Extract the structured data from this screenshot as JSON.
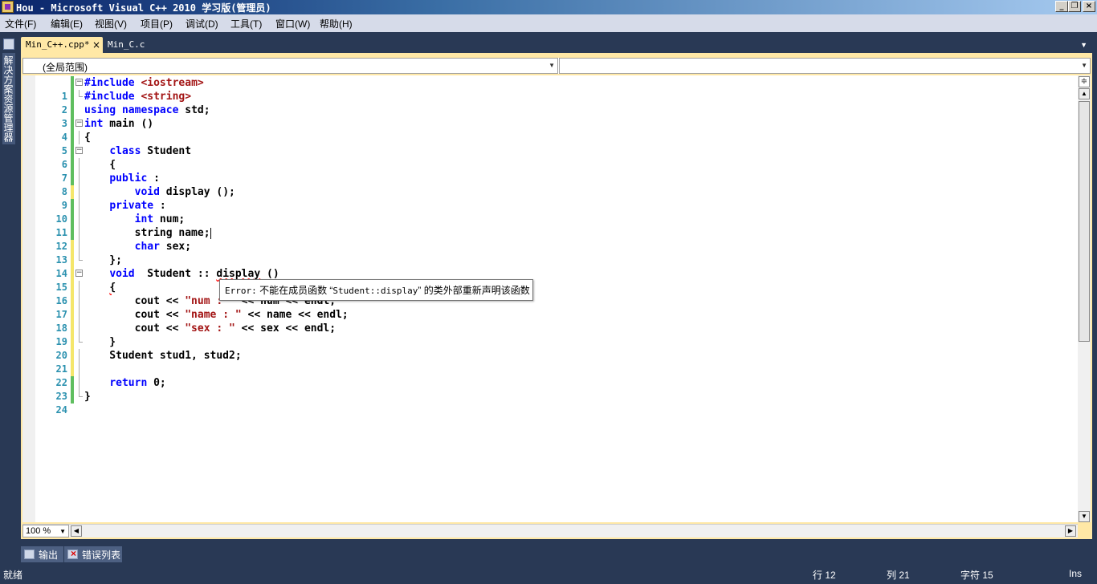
{
  "window": {
    "title": "Hou - Microsoft Visual C++ 2010 学习版(管理员)",
    "minimize": "_",
    "maximize": "❐",
    "close": "×"
  },
  "menu": [
    {
      "label": "文件(F)"
    },
    {
      "label": "编辑(E)"
    },
    {
      "label": "视图(V)"
    },
    {
      "label": "项目(P)"
    },
    {
      "label": "调试(D)"
    },
    {
      "label": "工具(T)"
    },
    {
      "label": "窗口(W)"
    },
    {
      "label": "帮助(H)"
    }
  ],
  "sidebar": {
    "solution_explorer_label": "解决方案资源管理器",
    "icon": "solution-explorer-icon"
  },
  "tabs": [
    {
      "label": "Min_C++.cpp*",
      "active": true,
      "close": "×"
    },
    {
      "label": "Min_C.c",
      "active": false
    }
  ],
  "navbar": {
    "scope": "(全局范围)",
    "member": ""
  },
  "editor": {
    "lines": [
      {
        "n": "1",
        "text": "#include <iostream>"
      },
      {
        "n": "2",
        "text": "#include <string>"
      },
      {
        "n": "3",
        "text": "using namespace std;"
      },
      {
        "n": "4",
        "text": "int main ()"
      },
      {
        "n": "5",
        "text": "{"
      },
      {
        "n": "6",
        "text": "    class Student"
      },
      {
        "n": "7",
        "text": "    {"
      },
      {
        "n": "8",
        "text": "    public :"
      },
      {
        "n": "9",
        "text": "        void display ();"
      },
      {
        "n": "10",
        "text": "    private :"
      },
      {
        "n": "11",
        "text": "        int num;"
      },
      {
        "n": "12",
        "text": "        string name;"
      },
      {
        "n": "13",
        "text": "        char sex;"
      },
      {
        "n": "14",
        "text": "    };"
      },
      {
        "n": "15",
        "text": "    void  Student :: display ()"
      },
      {
        "n": "16",
        "text": "    {"
      },
      {
        "n": "17",
        "text": "        cout << \"num : \" << num << endl;"
      },
      {
        "n": "18",
        "text": "        cout << \"name : \" << name << endl;"
      },
      {
        "n": "19",
        "text": "        cout << \"sex : \" << sex << endl;"
      },
      {
        "n": "20",
        "text": "    }"
      },
      {
        "n": "21",
        "text": "    Student stud1, stud2;"
      },
      {
        "n": "22",
        "text": ""
      },
      {
        "n": "23",
        "text": "    return 0;"
      },
      {
        "n": "24",
        "text": "}"
      }
    ],
    "tooltip": {
      "prefix": "Error:",
      "text1": " 不能在成员函数 “",
      "symbol": "Student::display",
      "text2": "” 的类外部重新声明该函数"
    },
    "zoom": "100 %"
  },
  "colors": {
    "keyword": "#0000ff",
    "string": "#a31515",
    "line_number": "#2b91af",
    "saved_change": "#5fbe5f",
    "unsaved_change": "#f5e66b",
    "frame": "#293955",
    "tab_active": "#ffe8a6"
  },
  "tool_tabs": [
    {
      "label": "输出",
      "icon": "output-icon"
    },
    {
      "label": "错误列表",
      "icon": "error-list-icon"
    }
  ],
  "status": {
    "state": "就绪",
    "line": "行 12",
    "col": "列 21",
    "char": "字符 15",
    "mode": "Ins"
  }
}
